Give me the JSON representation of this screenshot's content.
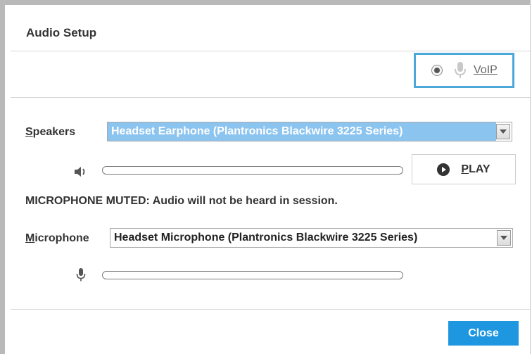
{
  "dialog": {
    "title": "Audio Setup"
  },
  "voip": {
    "label": "VoIP",
    "selected": true
  },
  "speakers": {
    "label_prefix": "S",
    "label_rest": "peakers",
    "selected_value": "Headset Earphone (Plantronics Blackwire 3225 Series)",
    "icon": "speaker-icon",
    "volume_level": 0
  },
  "play": {
    "label_prefix": "P",
    "label_rest": "LAY",
    "icon": "play-circle-icon"
  },
  "status": {
    "muted_message": "MICROPHONE MUTED: Audio will not be heard in session."
  },
  "microphone": {
    "label_prefix": "M",
    "label_rest": "icrophone",
    "selected_value": "Headset Microphone (Plantronics Blackwire 3225 Series)",
    "icon": "microphone-icon",
    "input_level": 0
  },
  "footer": {
    "close_label": "Close"
  },
  "colors": {
    "accent": "#1e97e0",
    "voip_border": "#4ba8d8",
    "select_highlight": "#8cc4f0"
  }
}
